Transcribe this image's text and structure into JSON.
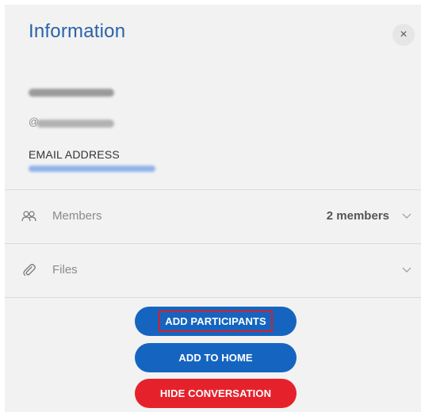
{
  "header": {
    "title": "Information",
    "close_glyph": "×"
  },
  "profile": {
    "at_symbol": "@",
    "email_label": "EMAIL ADDRESS"
  },
  "sections": {
    "members": {
      "label": "Members",
      "count": "2 members",
      "icon": "members-icon"
    },
    "files": {
      "label": "Files",
      "icon": "paperclip-icon"
    }
  },
  "actions": {
    "add_participants": "ADD PARTICIPANTS",
    "add_to_home": "ADD TO HOME",
    "hide_conversation": "HIDE CONVERSATION"
  },
  "colors": {
    "title": "#2a63a8",
    "primary_button": "#1565c0",
    "danger_button": "#e5222c",
    "highlight_border": "#d6202a"
  }
}
